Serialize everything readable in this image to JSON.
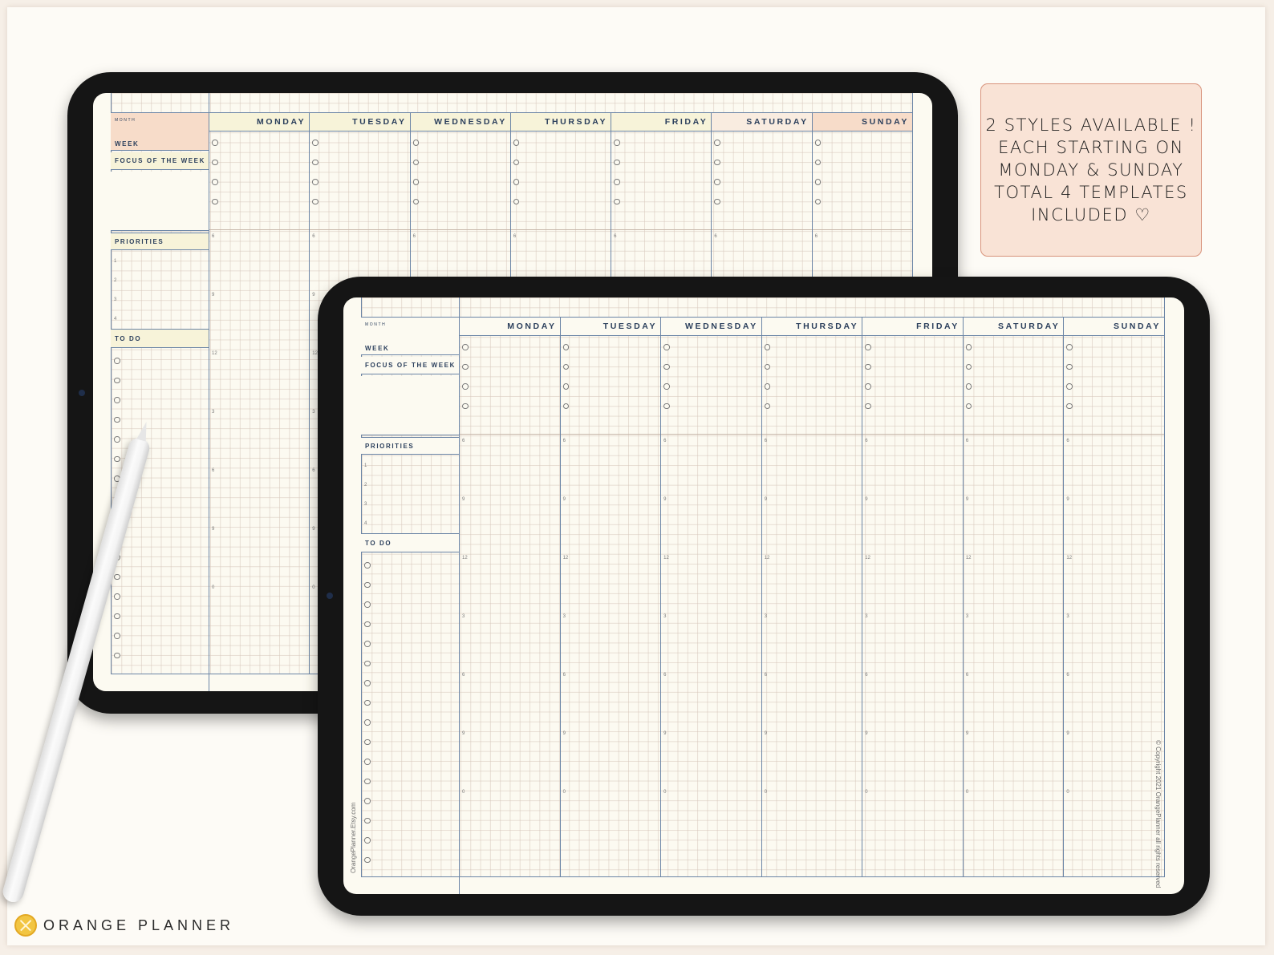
{
  "badge": {
    "lines": [
      "2 STYLES AVAILABLE !",
      "EACH STARTING ON",
      "MONDAY & SUNDAY",
      "TOTAL 4 TEMPLATES",
      "INCLUDED ♡"
    ]
  },
  "planner": {
    "month_label": "MONTH",
    "week_label": "WEEK",
    "focus_label": "FOCUS OF THE WEEK",
    "priorities_label": "PRIORITIES",
    "priority_numbers": [
      "1",
      "2",
      "3",
      "4"
    ],
    "todo_label": "TO DO",
    "days": [
      "MONDAY",
      "TUESDAY",
      "WEDNESDAY",
      "THURSDAY",
      "FRIDAY",
      "SATURDAY",
      "SUNDAY"
    ],
    "hours": [
      "6",
      "9",
      "12",
      "3",
      "6",
      "9",
      "0"
    ]
  },
  "colors": {
    "accent_peach": "#f7dcc9",
    "accent_cream": "#f7f3d9",
    "line_blue": "#6b85a6"
  },
  "side_texts": {
    "etsy": "OrangePlanner.Etsy.com",
    "copyright": "© Copyright 2021 OrangePlanner all rights reserved"
  },
  "brand": {
    "name": "ORANGE PLANNER"
  }
}
